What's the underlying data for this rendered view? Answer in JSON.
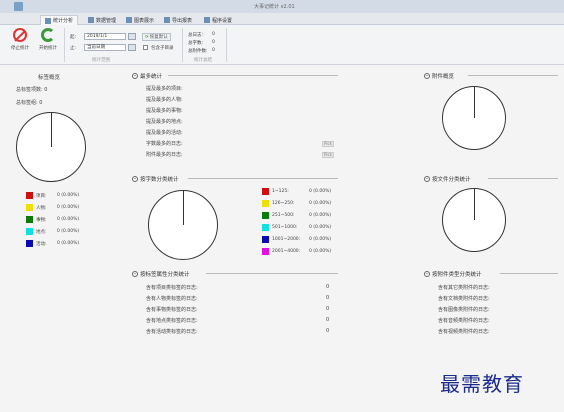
{
  "window": {
    "title": "大事记统计 v2.01"
  },
  "tabs": [
    {
      "label": "统计分析"
    },
    {
      "label": "数据管理"
    },
    {
      "label": "图表展示"
    },
    {
      "label": "导出报表"
    },
    {
      "label": "程序设置"
    }
  ],
  "ribbon": {
    "stop_label": "停止统计",
    "start_label": "开始统计",
    "from_label": "起:",
    "from_value": "2019/1/1",
    "to_label": "止:",
    "to_value": "当前日期",
    "reset_label": "恢复默认",
    "include_label": "包含子目录",
    "range_caption": "统计范围",
    "summary_caption": "统计总结",
    "summary": [
      {
        "label": "总日志:",
        "value": "0"
      },
      {
        "label": "总字数:",
        "value": "0"
      },
      {
        "label": "总附件数:",
        "value": "0"
      }
    ]
  },
  "tag_overview": {
    "title": "标签概览",
    "total_items": "总标签项数: 0",
    "total_groups": "总标签组: 0",
    "legend": [
      {
        "label": "项目:",
        "value": "0 (0.00%)",
        "color": "#d01010"
      },
      {
        "label": "人物:",
        "value": "0 (0.00%)",
        "color": "#f0e000"
      },
      {
        "label": "事物:",
        "value": "0 (0.00%)",
        "color": "#0a7a0a"
      },
      {
        "label": "地点:",
        "value": "0 (0.00%)",
        "color": "#10e0e0"
      },
      {
        "label": "活动:",
        "value": "0 (0.00%)",
        "color": "#0a0ab0"
      }
    ]
  },
  "most_stats": {
    "title": "最多统计",
    "rows": [
      "提及最多的项目:",
      "提及最多的人物:",
      "提及最多的事物:",
      "提及最多的地点:",
      "提及最多的活动:",
      "字数最多的日志:",
      "附件最多的日志:"
    ],
    "pick_label": "Pick"
  },
  "attach_overview": {
    "title": "附件概览"
  },
  "word_stats": {
    "title": "按字数分类统计",
    "legend": [
      {
        "label": "1~125:",
        "value": "0 (0.00%)",
        "color": "#d01010"
      },
      {
        "label": "126~250:",
        "value": "0 (0.00%)",
        "color": "#f0e000"
      },
      {
        "label": "251~500:",
        "value": "0 (0.00%)",
        "color": "#0a7a0a"
      },
      {
        "label": "501~1000:",
        "value": "0 (0.00%)",
        "color": "#10e0e0"
      },
      {
        "label": "1001~2000:",
        "value": "0 (0.00%)",
        "color": "#0a0ab0"
      },
      {
        "label": "2001~4000:",
        "value": "0 (0.00%)",
        "color": "#e010e0"
      }
    ]
  },
  "file_type_stats": {
    "title": "按文件分类统计"
  },
  "tag_attr_stats": {
    "title": "按标签属性分类统计",
    "rows": [
      {
        "label": "含有项目类标签的日志:",
        "value": "0"
      },
      {
        "label": "含有人物类标签的日志:",
        "value": "0"
      },
      {
        "label": "含有事物类标签的日志:",
        "value": "0"
      },
      {
        "label": "含有地点类标签的日志:",
        "value": "0"
      },
      {
        "label": "含有活动类标签的日志:",
        "value": "0"
      }
    ]
  },
  "attach_type_stats": {
    "title": "按附件类型分类统计",
    "rows": [
      "含有其它类附件的日志:",
      "含有文档类附件的日志:",
      "含有图像类附件的日志:",
      "含有音频类附件的日志:",
      "含有视频类附件的日志:"
    ]
  },
  "watermark": "最需教育"
}
